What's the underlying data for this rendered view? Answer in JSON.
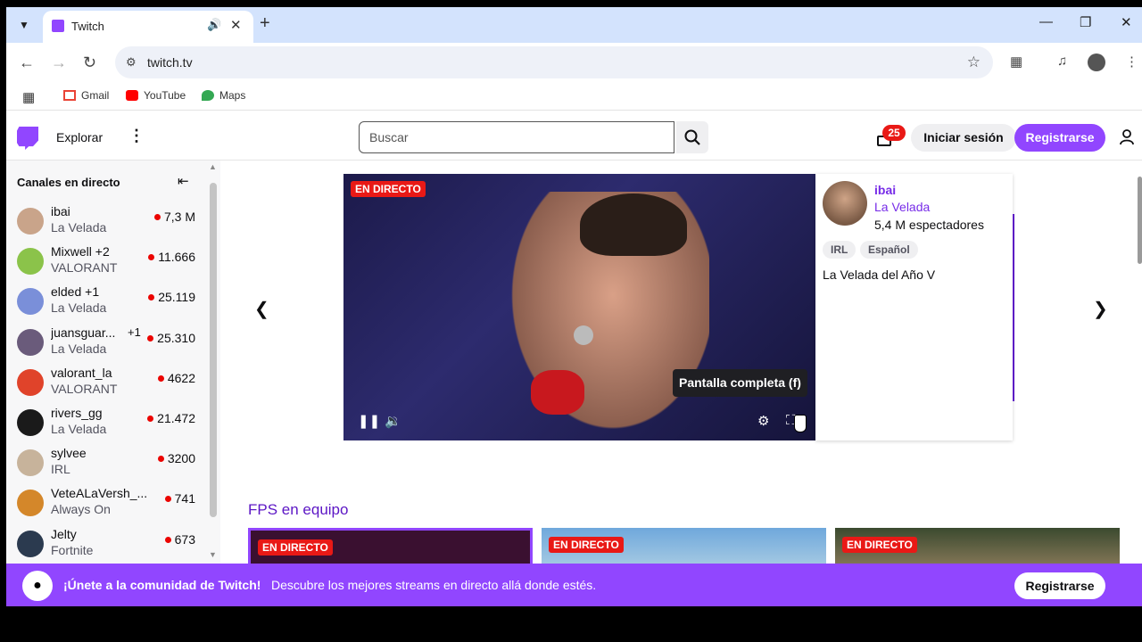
{
  "browser": {
    "tab_title": "Twitch",
    "url": "twitch.tv",
    "bookmarks": [
      {
        "label": "Gmail",
        "color": "#ea4335"
      },
      {
        "label": "YouTube",
        "color": "#ff0000"
      },
      {
        "label": "Maps",
        "color": "#34a853"
      }
    ]
  },
  "nav": {
    "explore": "Explorar",
    "search_placeholder": "Buscar",
    "notif_count": "25",
    "login": "Iniciar sesión",
    "signup": "Registrarse"
  },
  "sidebar": {
    "header": "Canales en directo",
    "channels": [
      {
        "name": "ibai",
        "extra": "",
        "game": "La Velada",
        "viewers": "7,3 M",
        "color": "#c9a48a"
      },
      {
        "name": "Mixwell +2",
        "extra": "",
        "game": "VALORANT",
        "viewers": "11.666",
        "color": "#8bc34a"
      },
      {
        "name": "elded +1",
        "extra": "",
        "game": "La Velada",
        "viewers": "25.119",
        "color": "#7a8fd9"
      },
      {
        "name": "juansguar...",
        "extra": "+1",
        "game": "La Velada",
        "viewers": "25.310",
        "color": "#6a5b7b"
      },
      {
        "name": "valorant_la",
        "extra": "",
        "game": "VALORANT",
        "viewers": "4622",
        "color": "#e0432a"
      },
      {
        "name": "rivers_gg",
        "extra": "",
        "game": "La Velada",
        "viewers": "21.472",
        "color": "#1a1a1a"
      },
      {
        "name": "sylvee",
        "extra": "",
        "game": "IRL",
        "viewers": "3200",
        "color": "#c7b39b"
      },
      {
        "name": "VeteALaVersh_...",
        "extra": "",
        "game": "Always On",
        "viewers": "741",
        "color": "#d4872a"
      },
      {
        "name": "Jelty",
        "extra": "",
        "game": "Fortnite",
        "viewers": "673",
        "color": "#2b3a4f"
      }
    ]
  },
  "featured": {
    "live_label": "EN DIRECTO",
    "tooltip": "Pantalla completa (f)",
    "channel": "ibai",
    "category": "La Velada",
    "viewers": "5,4 M espectadores",
    "tags": [
      "IRL",
      "Español"
    ],
    "title": "La Velada del Año V"
  },
  "section": {
    "title": "FPS en equipo",
    "live_label": "EN DIRECTO"
  },
  "banner": {
    "title": "¡Únete a la comunidad de Twitch!",
    "text": "Descubre los mejores streams en directo allá donde estés.",
    "button": "Registrarse"
  }
}
